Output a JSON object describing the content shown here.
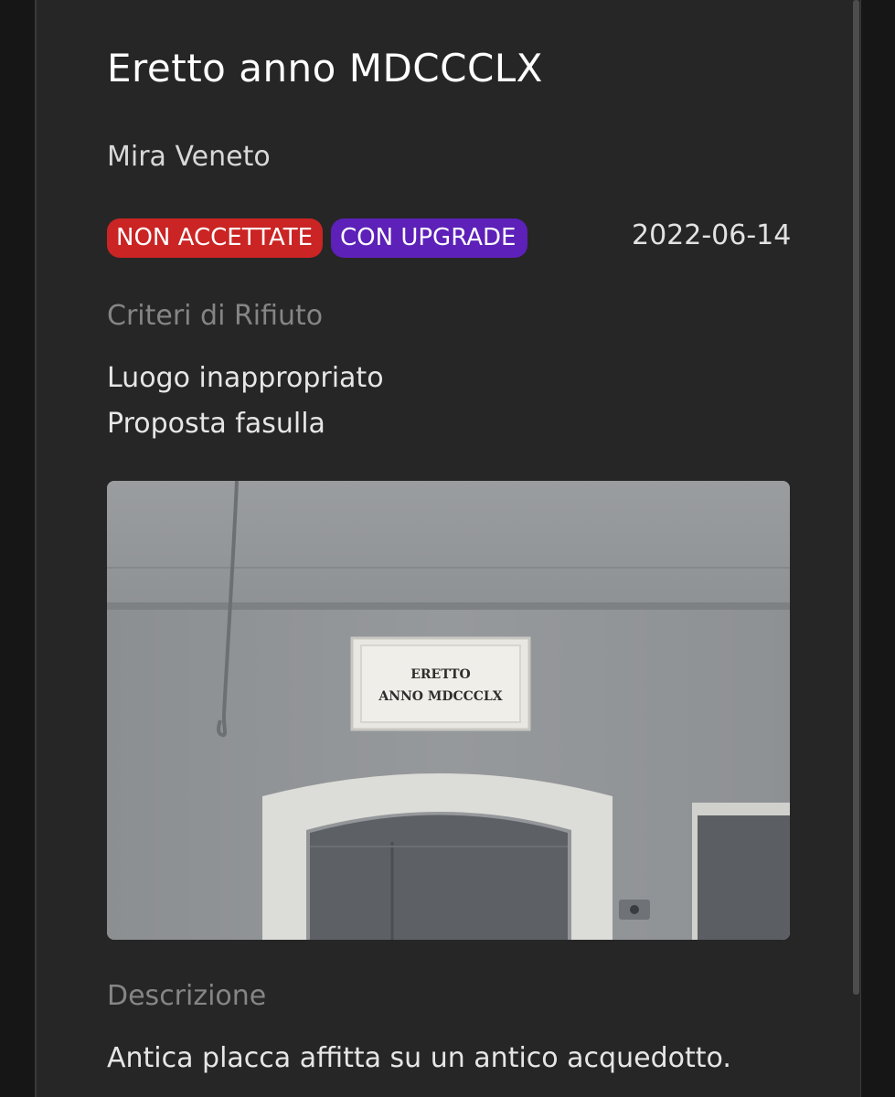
{
  "card": {
    "title": "Eretto anno MDCCCLX",
    "location": "Mira Veneto",
    "badges": {
      "rejected": "NON ACCETTATE",
      "upgrade": "CON UPGRADE"
    },
    "badge_colors": {
      "rejected": "#cb2424",
      "upgrade": "#5d20b8"
    },
    "date": "2022-06-14",
    "criteria_label": "Criteri di Rifiuto",
    "criteria": [
      "Luogo inappropriato",
      "Proposta fasulla"
    ],
    "photo": {
      "plaque_line1": "ERETTO",
      "plaque_line2": "ANNO MDCCCLX"
    },
    "description_label": "Descrizione",
    "description": "Antica placca affitta su un antico acquedotto."
  },
  "colors": {
    "background": "#161616",
    "panel": "#262626",
    "muted_text": "#858585"
  }
}
